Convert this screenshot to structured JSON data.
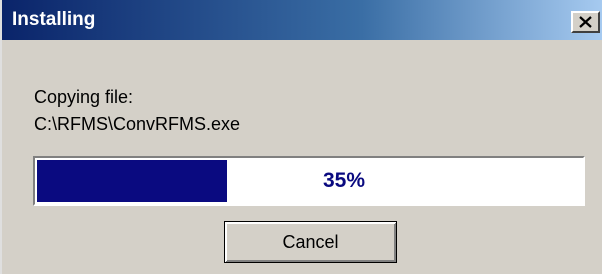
{
  "window": {
    "title": "Installing",
    "close_icon": "close-x-icon"
  },
  "message": {
    "line1": "Copying file:",
    "line2": "C:\\RFMS\\ConvRFMS.exe"
  },
  "progress": {
    "percent": 35,
    "label": "35%",
    "fill_color": "#0a0a80"
  },
  "buttons": {
    "cancel_label": "Cancel"
  },
  "colors": {
    "title_gradient_start": "#0a246a",
    "title_gradient_end": "#a6caf0",
    "dialog_background": "#d4d0c8"
  }
}
